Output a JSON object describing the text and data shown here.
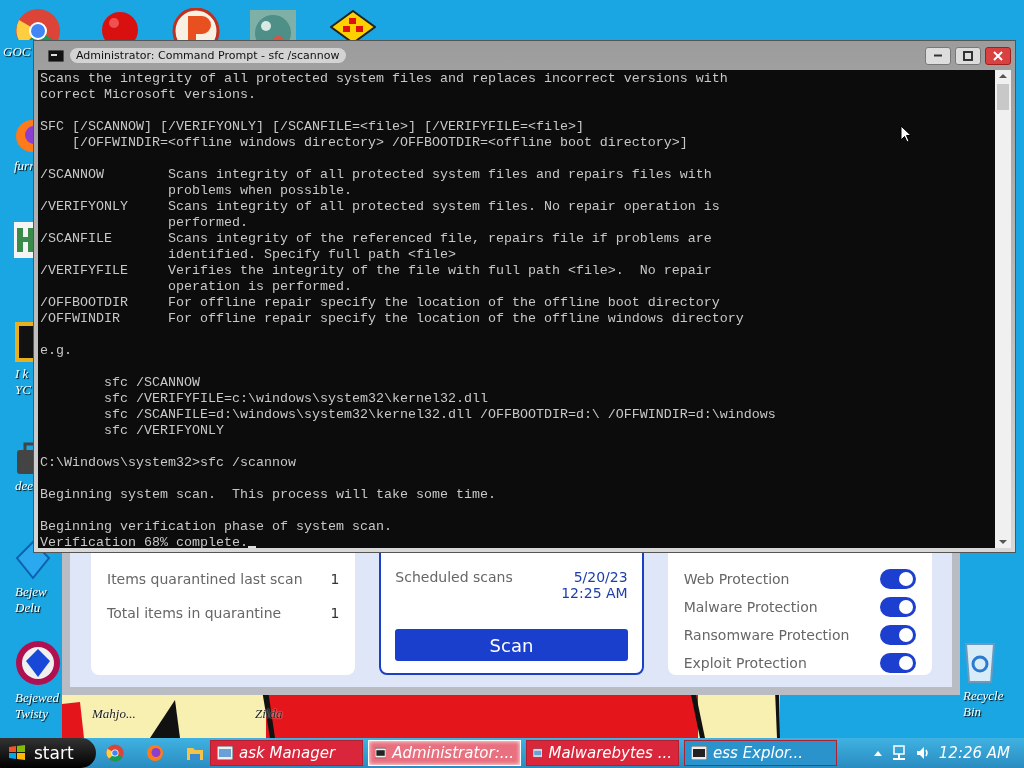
{
  "desktop_icons": [
    {
      "kind": "chrome",
      "label": "GOC"
    },
    {
      "kind": "ball"
    },
    {
      "kind": "letter"
    },
    {
      "kind": "sphere"
    },
    {
      "kind": "diamond"
    },
    {
      "kind": "firefox",
      "label": "furr"
    },
    {
      "kind": "app"
    },
    {
      "kind": "square",
      "label": "I k\nYC"
    },
    {
      "kind": "bag",
      "label": "dee"
    },
    {
      "kind": "gem",
      "label": "Bejew\nDelu"
    },
    {
      "kind": "twisty",
      "label": "Bejewed\nTwisty"
    },
    {
      "kind": "text",
      "label": "Mahjo..."
    },
    {
      "kind": "text",
      "label": "Zilda"
    },
    {
      "kind": "bin",
      "label": "Recycle Bin"
    }
  ],
  "malwarebytes": {
    "stats": [
      {
        "label": "Items quarantined last scan",
        "value": "1"
      },
      {
        "label": "Total items in quarantine",
        "value": "1"
      }
    ],
    "schedule": {
      "label": "Scheduled scans",
      "date": "5/20/23",
      "time": "12:25 AM"
    },
    "scan_button": "Scan",
    "protections": [
      {
        "label": "Web Protection",
        "on": true
      },
      {
        "label": "Malware Protection",
        "on": true
      },
      {
        "label": "Ransomware Protection",
        "on": true
      },
      {
        "label": "Exploit Protection",
        "on": true
      }
    ]
  },
  "console": {
    "title": "Administrator: Command Prompt - sfc  /scannow",
    "blocks": [
      "Scans the integrity of all protected system files and replaces incorrect versions with\ncorrect Microsoft versions.",
      "SFC [/SCANNOW] [/VERIFYONLY] [/SCANFILE=<file>] [/VERIFYFILE=<file>]\n    [/OFFWINDIR=<offline windows directory> /OFFBOOTDIR=<offline boot directory>]",
      "/SCANNOW        Scans integrity of all protected system files and repairs files with\n                problems when possible.\n/VERIFYONLY     Scans integrity of all protected system files. No repair operation is\n                performed.\n/SCANFILE       Scans integrity of the referenced file, repairs file if problems are\n                identified. Specify full path <file>\n/VERIFYFILE     Verifies the integrity of the file with full path <file>.  No repair\n                operation is performed.\n/OFFBOOTDIR     For offline repair specify the location of the offline boot directory\n/OFFWINDIR      For offline repair specify the location of the offline windows directory",
      "e.g.",
      "        sfc /SCANNOW\n        sfc /VERIFYFILE=c:\\windows\\system32\\kernel32.dll\n        sfc /SCANFILE=d:\\windows\\system32\\kernel32.dll /OFFBOOTDIR=d:\\ /OFFWINDIR=d:\\windows\n        sfc /VERIFYONLY",
      "C:\\Windows\\system32>sfc /scannow",
      "Beginning system scan.  This process will take some time.",
      "Beginning verification phase of system scan.\nVerification 68% complete."
    ]
  },
  "taskbar": {
    "start": "start",
    "tasks": [
      {
        "label": "ask Manager",
        "color": "#d9263a",
        "selected": false
      },
      {
        "label": "Administrator:...",
        "color": "#e8707f",
        "selected": true
      },
      {
        "label": "Malwarebytes ...",
        "color": "#d9263a",
        "selected": false
      },
      {
        "label": "ess Explor...",
        "color": "#2b93cc",
        "selected": false
      }
    ],
    "clock": "12:26 AM"
  }
}
